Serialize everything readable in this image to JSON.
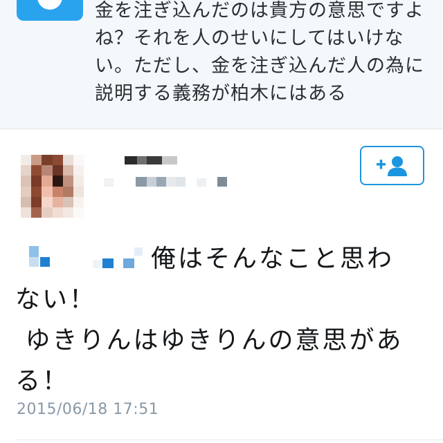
{
  "parent_tweet": {
    "text_lines": [
      "金を注ぎ込んだのは貴方の意思ですよ",
      "ね？それを人のせいにしてはいけな",
      "い。ただし、金を注ぎ込んだ人の為に",
      "説明する義務が柏木にはある"
    ],
    "avatar_color": "#2aa3ef"
  },
  "tweet": {
    "body_lines": [
      "俺はそんなこと思わ",
      "ない！",
      " ゆきりんはゆきりんの意思があ",
      "る！"
    ],
    "timestamp": "2015/06/18 17:51",
    "follow_icon": "add-user-icon",
    "accent_color": "#1b95e0",
    "text_color": "#14171a",
    "muted_color": "#8899a6"
  }
}
